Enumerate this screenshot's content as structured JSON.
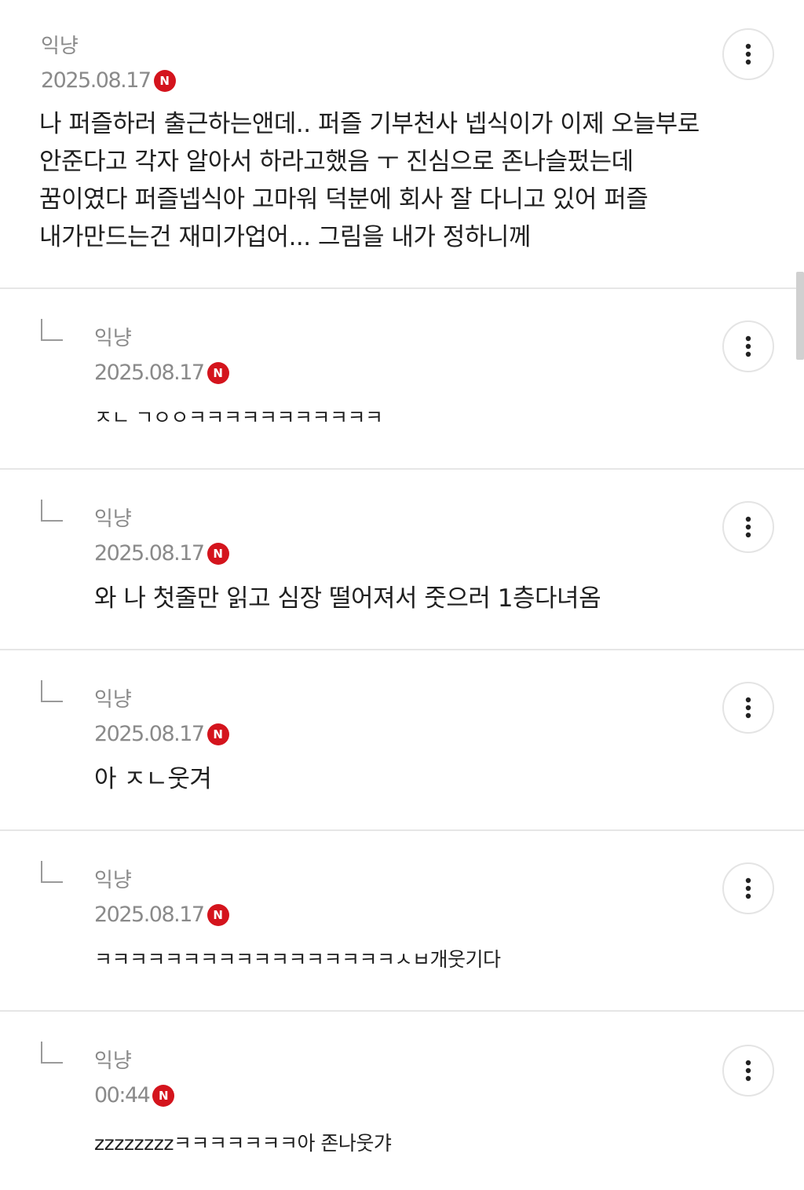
{
  "badge_label": "N",
  "comments": [
    {
      "author": "익냥",
      "date": "2025.08.17",
      "text": "나 퍼즐하러 출근하는앤데.. 퍼즐 기부천사 넵식이가 이제 오늘부로\n안준다고 각자 알아서 하라고했음 ㅜ 진심으로 존나슬펐는데\n꿈이였다 퍼즐넵식아 고마워 덕분에 회사 잘 다니고 있어 퍼즐\n내가만드는건 재미가업어... 그림을 내가 정하니께",
      "is_reply": false
    },
    {
      "author": "익냥",
      "date": "2025.08.17",
      "text": "ㅈㄴ ㄱㅇㅇㅋㅋㅋㅋㅋㅋㅋㅋㅋㅋㅋ",
      "is_reply": true
    },
    {
      "author": "익냥",
      "date": "2025.08.17",
      "text": "와 나 첫줄만 읽고 심장 떨어져서 줏으러 1층다녀옴",
      "is_reply": true
    },
    {
      "author": "익냥",
      "date": "2025.08.17",
      "text": "아 ㅈㄴ웃겨",
      "is_reply": true
    },
    {
      "author": "익냥",
      "date": "2025.08.17",
      "text": "ㅋㅋㅋㅋㅋㅋㅋㅋㅋㅋㅋㅋㅋㅋㅋㅋㅋㅅㅂ개웃기다",
      "is_reply": true
    },
    {
      "author": "익냥",
      "date": "00:44",
      "text": "zzzzzzzzㅋㅋㅋㅋㅋㅋㅋ아 존나웃갸",
      "is_reply": true
    }
  ]
}
